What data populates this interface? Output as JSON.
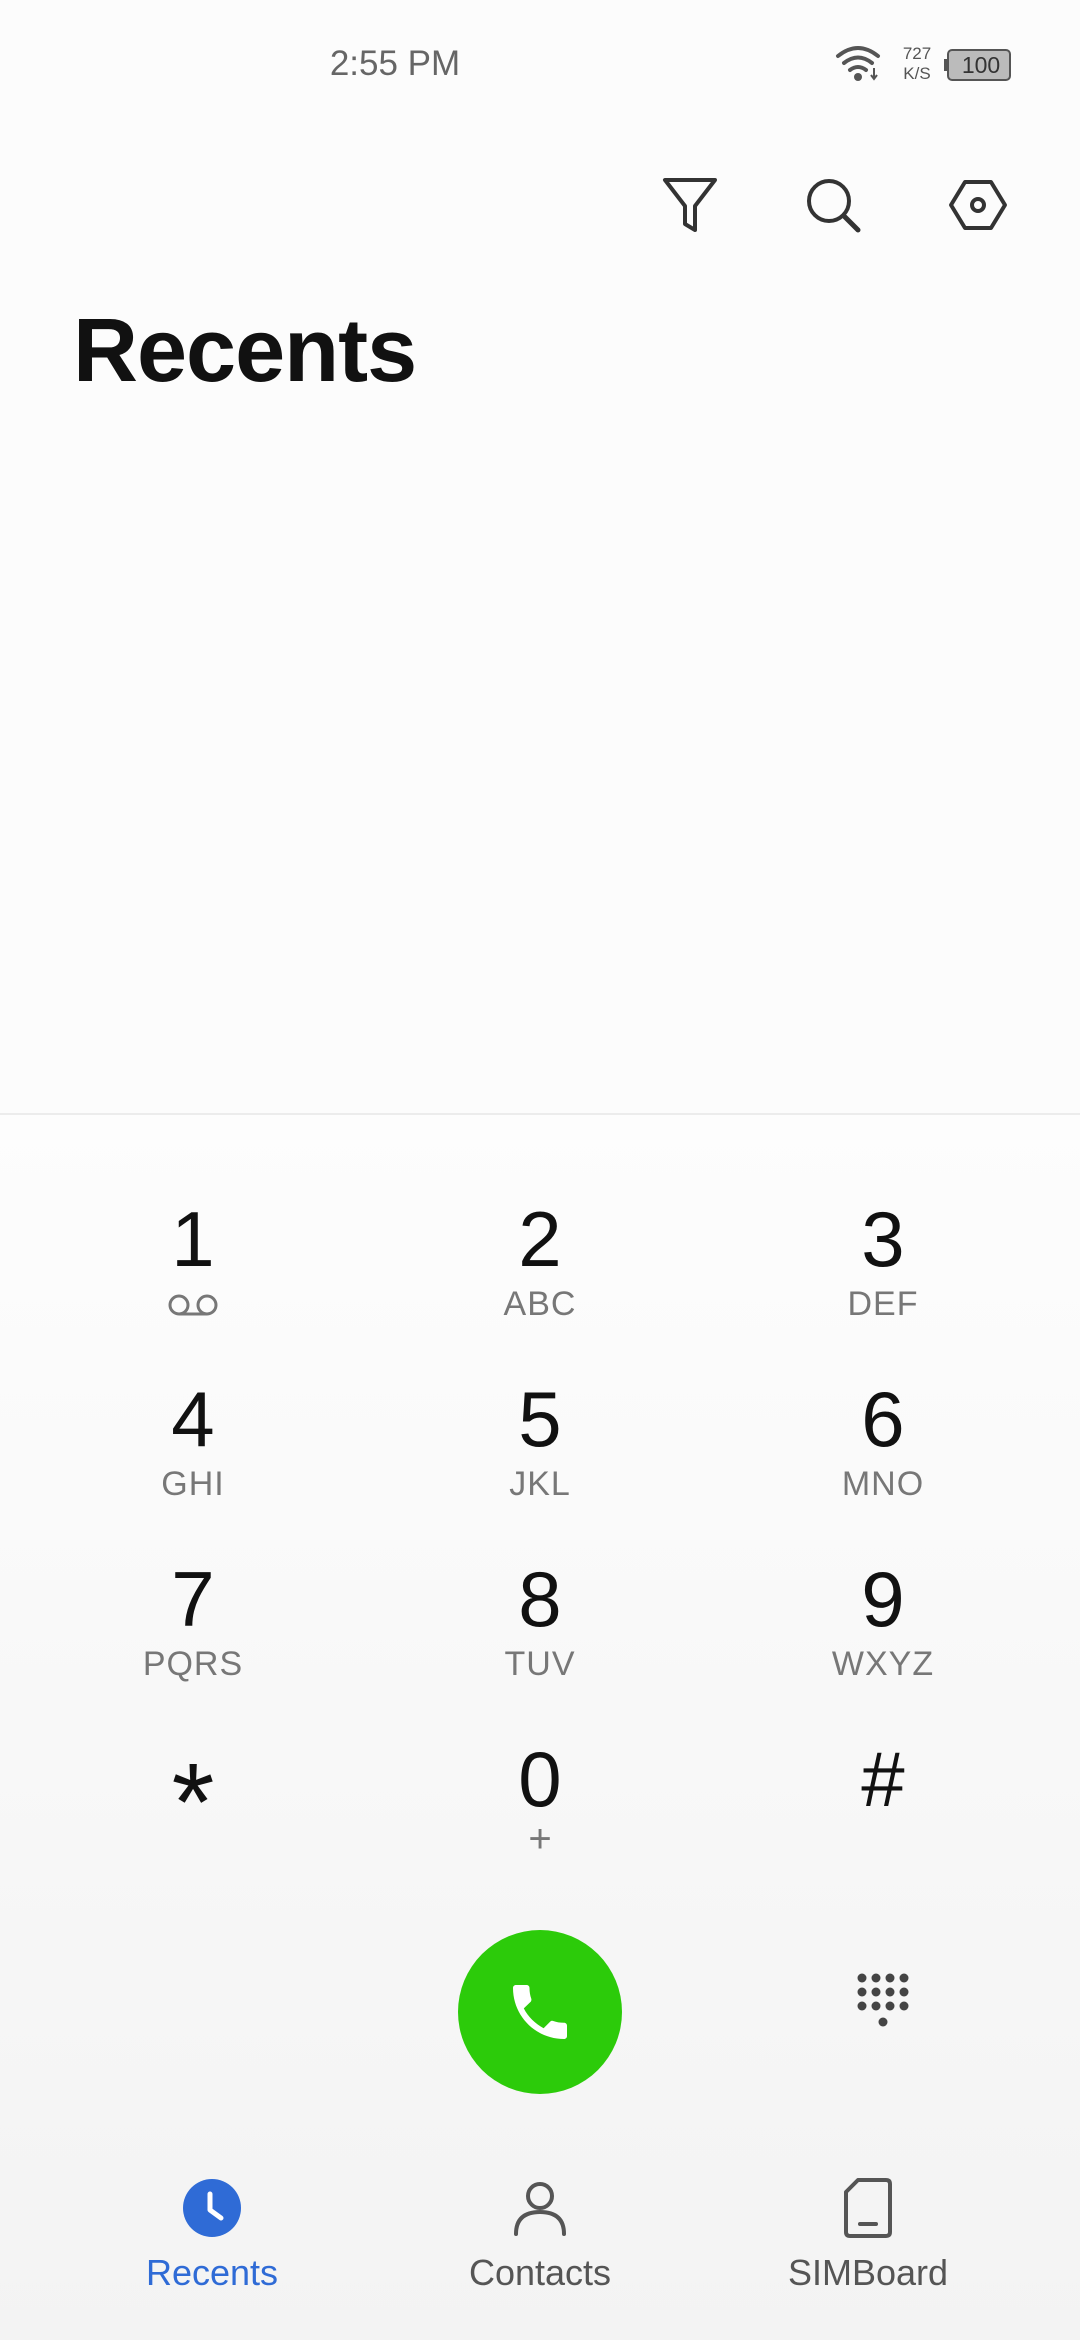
{
  "status_bar": {
    "time": "2:55 PM",
    "net_speed_value": "727",
    "net_speed_unit": "K/S",
    "battery": "100",
    "icons": [
      "wifi-icon",
      "battery-icon"
    ]
  },
  "toolbar": {
    "icons": [
      "filter-icon",
      "search-icon",
      "settings-icon"
    ]
  },
  "page": {
    "title": "Recents"
  },
  "dialpad": {
    "keys": [
      {
        "digit": "1",
        "letters": "",
        "icon": "voicemail-icon"
      },
      {
        "digit": "2",
        "letters": "ABC"
      },
      {
        "digit": "3",
        "letters": "DEF"
      },
      {
        "digit": "4",
        "letters": "GHI"
      },
      {
        "digit": "5",
        "letters": "JKL"
      },
      {
        "digit": "6",
        "letters": "MNO"
      },
      {
        "digit": "7",
        "letters": "PQRS"
      },
      {
        "digit": "8",
        "letters": "TUV"
      },
      {
        "digit": "9",
        "letters": "WXYZ"
      },
      {
        "digit": "*",
        "letters": ""
      },
      {
        "digit": "0",
        "letters": "+"
      },
      {
        "digit": "#",
        "letters": ""
      }
    ],
    "call_icon": "phone-icon",
    "toggle_icon": "dialpad-icon"
  },
  "bottom_nav": {
    "items": [
      {
        "label": "Recents",
        "icon": "clock-icon",
        "active": true
      },
      {
        "label": "Contacts",
        "icon": "person-icon",
        "active": false
      },
      {
        "label": "SIMBoard",
        "icon": "sim-card-icon",
        "active": false
      }
    ]
  },
  "colors": {
    "accent": "#2f6bd6",
    "call_green": "#2ccb0a",
    "background": "#fcfcfc"
  }
}
